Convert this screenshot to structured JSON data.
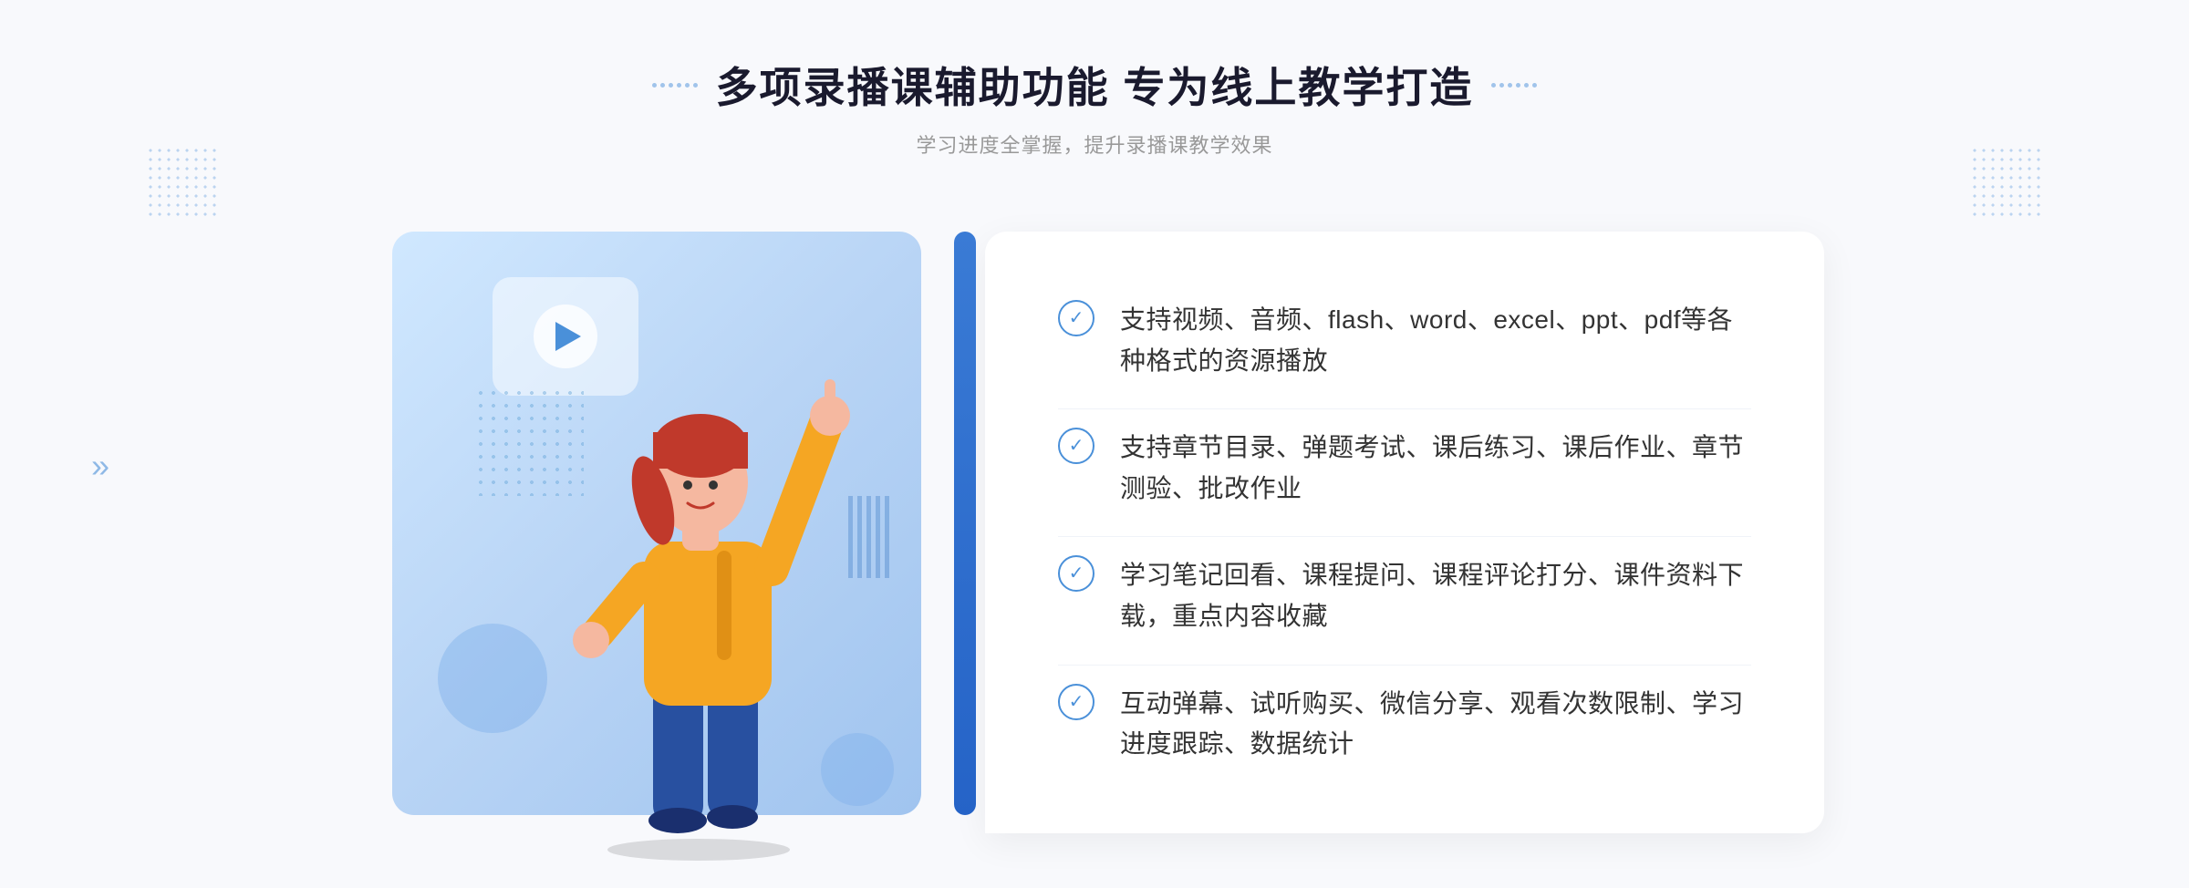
{
  "header": {
    "title": "多项录播课辅助功能 专为线上教学打造",
    "subtitle": "学习进度全掌握，提升录播课教学效果",
    "left_dots_label": "decorative-dots-left",
    "right_dots_label": "decorative-dots-right"
  },
  "features": [
    {
      "id": 1,
      "text": "支持视频、音频、flash、word、excel、ppt、pdf等各种格式的资源播放"
    },
    {
      "id": 2,
      "text": "支持章节目录、弹题考试、课后练习、课后作业、章节测验、批改作业"
    },
    {
      "id": 3,
      "text": "学习笔记回看、课程提问、课程评论打分、课件资料下载，重点内容收藏"
    },
    {
      "id": 4,
      "text": "互动弹幕、试听购买、微信分享、观看次数限制、学习进度跟踪、数据统计"
    }
  ],
  "icons": {
    "check": "✓",
    "play": "▶",
    "arrow_right": "»"
  },
  "colors": {
    "primary": "#4a90d9",
    "dark": "#1a1a2e",
    "text": "#333333",
    "subtitle": "#999999",
    "bg": "#f8f9fc",
    "white": "#ffffff"
  }
}
